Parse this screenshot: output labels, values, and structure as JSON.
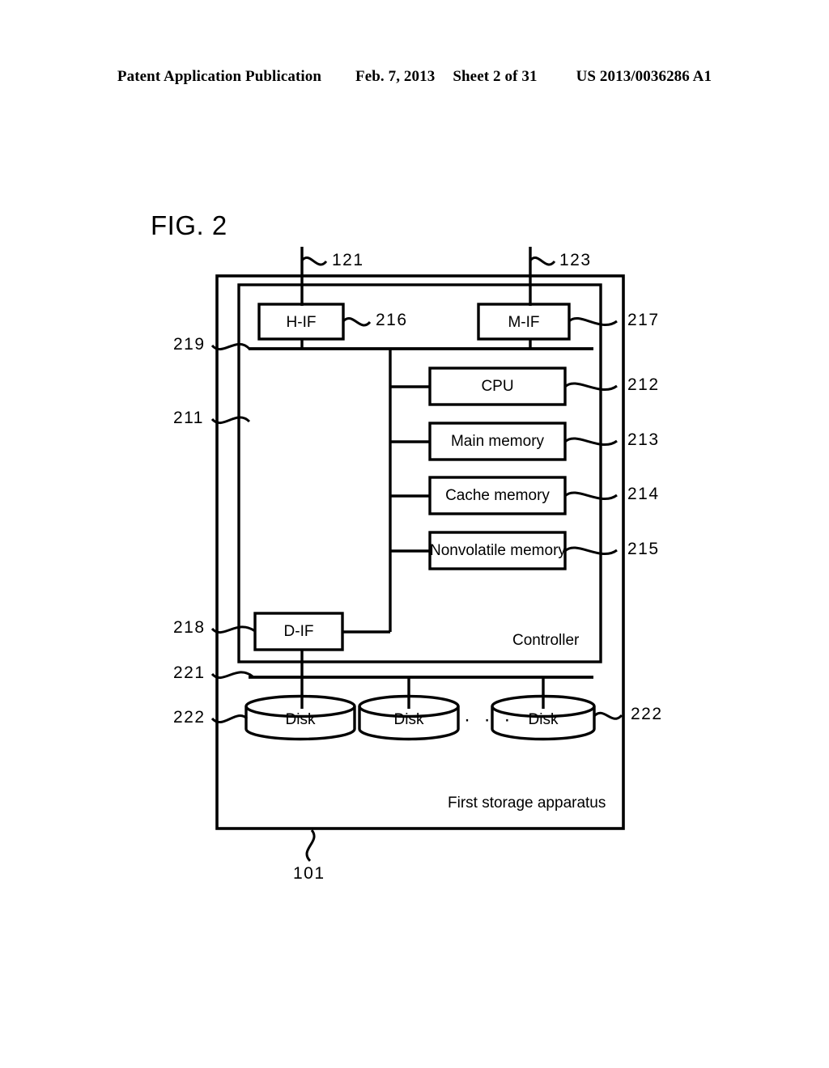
{
  "header": {
    "publication": "Patent Application Publication",
    "date": "Feb. 7, 2013",
    "sheet": "Sheet 2 of 31",
    "document_number": "US 2013/0036286 A1"
  },
  "figure": {
    "title": "FIG. 2",
    "outer_label": "First storage apparatus",
    "controller_label": "Controller",
    "ellipsis": "· · ·",
    "blocks": {
      "h_if": "H-IF",
      "m_if": "M-IF",
      "d_if": "D-IF",
      "cpu": "CPU",
      "main_memory": "Main memory",
      "cache_memory": "Cache memory",
      "nonvolatile_memory": "Nonvolatile memory",
      "disk_1": "Disk",
      "disk_2": "Disk",
      "disk_3": "Disk"
    },
    "reference_numerals": {
      "host_link": "121",
      "mgmt_link": "123",
      "h_if": "216",
      "m_if": "217",
      "cpu": "212",
      "main_memory": "213",
      "cache_memory": "214",
      "nonvolatile_memory": "215",
      "internal_bus": "219",
      "controller": "211",
      "d_if": "218",
      "disk_bus": "221",
      "disk_left": "222",
      "disk_right": "222",
      "apparatus": "101"
    }
  },
  "colors": {
    "ink": "#000000",
    "paper": "#ffffff"
  }
}
